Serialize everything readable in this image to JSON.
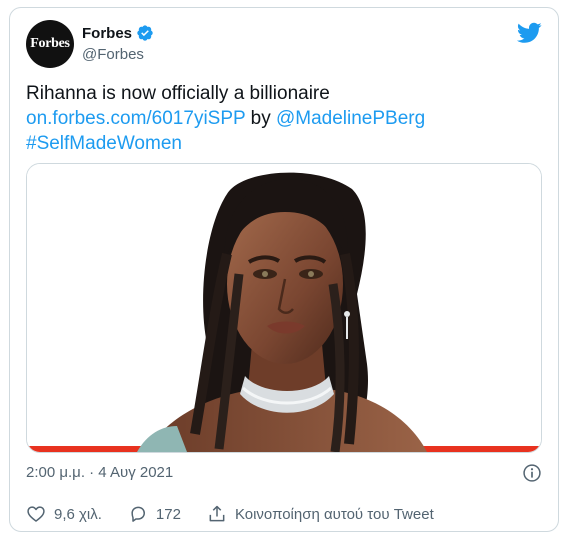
{
  "author": {
    "display_name": "Forbes",
    "handle": "@Forbes",
    "avatar_text": "Forbes",
    "verified": true
  },
  "tweet": {
    "text": "Rihanna is now officially a billionaire",
    "link": "on.forbes.com/6017yiSPP",
    "by": "by",
    "mention": "@MadelinePBerg",
    "hashtag": "#SelfMadeWomen"
  },
  "media": {
    "kind": "illustration-portrait",
    "accent_bar_color": "#e8321f"
  },
  "meta": {
    "timestamp": "2:00 μ.μ. · 4 Αυγ 2021"
  },
  "actions": {
    "likes": "9,6 χιλ.",
    "replies": "172",
    "share_label": "Κοινοποίηση αυτού του Tweet"
  },
  "colors": {
    "accent": "#1d9bf0",
    "text": "#0f1419",
    "secondary": "#536471",
    "border": "#cfd9de"
  },
  "icons": [
    "verified-badge-icon",
    "twitter-bird-icon",
    "info-icon",
    "heart-icon",
    "reply-icon",
    "share-icon"
  ]
}
